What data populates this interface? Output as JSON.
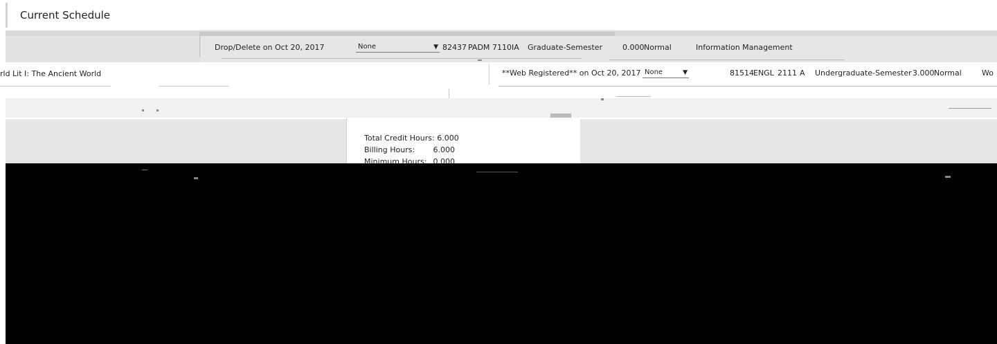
{
  "page": {
    "title": "Current Schedule"
  },
  "rows": [
    {
      "status": "Drop/Delete on Oct 20, 2017",
      "action": "None",
      "crn": "82437",
      "subject": "PADM",
      "course": "7110",
      "section": "IA",
      "level": "Graduate-Semester",
      "credit": "0.000",
      "grade_mode": "Normal",
      "title": "Information Management"
    },
    {
      "title_partial": "rld Lit I: The Ancient World",
      "status": "**Web Registered** on Oct 20, 2017",
      "action": "None",
      "crn": "81514",
      "subject": "ENGL",
      "course": "2111",
      "section": "A",
      "level": "Undergraduate-Semester",
      "credit": "3.000",
      "grade_mode": "Normal",
      "trailing": "Wo"
    }
  ],
  "totals": {
    "credit_label": "Total Credit Hours:",
    "credit_value": "6.000",
    "billing_label": "Billing Hours:",
    "billing_value": "6.000",
    "minimum_label": "Minimum Hours:",
    "minimum_value": "0.000"
  }
}
